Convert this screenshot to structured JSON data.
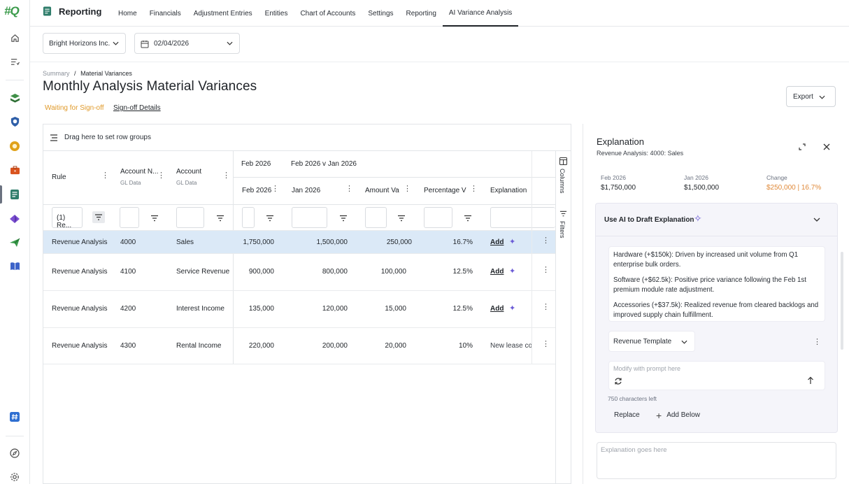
{
  "app": {
    "logo_text": "#Q",
    "title": "Reporting"
  },
  "nav": {
    "items": [
      "Home",
      "Financials",
      "Adjustment Entries",
      "Entities",
      "Chart of Accounts",
      "Settings",
      "Reporting",
      "AI Variance Analysis"
    ],
    "active_index": 7
  },
  "rail": {
    "icons": [
      "home-icon",
      "tasks-icon",
      "stack-icon",
      "shield-icon",
      "coin-icon",
      "briefcase-icon",
      "reporting-icon",
      "diamond-icon",
      "send-icon",
      "book-icon",
      "hash-icon",
      "compass-icon",
      "settings-icon"
    ]
  },
  "filters": {
    "entity": "Bright Horizons Inc.",
    "date": "02/04/2026"
  },
  "page": {
    "breadcrumb_parent": "Summary",
    "breadcrumb_sep": "/",
    "breadcrumb_current": "Material Variances",
    "title": "Monthly Analysis Material Variances",
    "status": "Waiting for Sign-off",
    "signoff_link": "Sign-off Details",
    "export_label": "Export"
  },
  "grid": {
    "row_groups_hint": "Drag here to set row groups",
    "group_header_1": "Feb 2026",
    "group_header_2": "Feb 2026 v Jan 2026",
    "columns": {
      "rule": "Rule",
      "account_no": "Account N...",
      "account_no_sub": "GL Data",
      "account": "Account",
      "account_sub": "GL Data",
      "feb": "Feb 2026",
      "jan": "Jan 2026",
      "amount": "Amount Va",
      "percentage": "Percentage V",
      "explanation": "Explanation"
    },
    "rule_filter_value": "(1) Re...",
    "side_tabs": [
      "Columns",
      "Filters"
    ],
    "add_label": "Add",
    "rows": [
      {
        "rule": "Revenue Analysis",
        "acct_no": "4000",
        "account": "Sales",
        "feb": "1,750,000",
        "jan": "1,500,000",
        "amount": "250,000",
        "pct": "16.7%",
        "explanation": "Add",
        "selected": true
      },
      {
        "rule": "Revenue Analysis",
        "acct_no": "4100",
        "account": "Service Revenue",
        "feb": "900,000",
        "jan": "800,000",
        "amount": "100,000",
        "pct": "12.5%",
        "explanation": "Add",
        "selected": false
      },
      {
        "rule": "Revenue Analysis",
        "acct_no": "4200",
        "account": "Interest Income",
        "feb": "135,000",
        "jan": "120,000",
        "amount": "15,000",
        "pct": "12.5%",
        "explanation": "Add",
        "selected": false
      },
      {
        "rule": "Revenue Analysis",
        "acct_no": "4300",
        "account": "Rental Income",
        "feb": "220,000",
        "jan": "200,000",
        "amount": "20,000",
        "pct": "10%",
        "explanation": "New lease co",
        "selected": false
      }
    ]
  },
  "panel": {
    "title": "Explanation",
    "subtitle": "Revenue Analysis: 4000: Sales",
    "kpis": [
      {
        "label": "Feb 2026",
        "value": "$1,750,000"
      },
      {
        "label": "Jan 2026",
        "value": "$1,500,000"
      },
      {
        "label": "Change",
        "value": "$250,000 | 16.7%"
      }
    ],
    "ai": {
      "heading": "Use AI to Draft Explanation",
      "draft": [
        "Hardware (+$150k): Driven by increased unit volume from Q1 enterprise bulk orders.",
        "Software (+$62.5k): Positive price variance following the Feb 1st premium module rate adjustment.",
        "Accessories (+$37.5k): Realized revenue from cleared backlogs and improved supply chain fulfillment."
      ],
      "template": "Revenue Template",
      "prompt_placeholder": "Modify with prompt here",
      "chars_left": "750 characters left",
      "replace_label": "Replace",
      "add_below_label": "Add Below"
    },
    "explanation_placeholder": "Explanation goes here"
  },
  "colors": {
    "accent_selected_row": "#dbe9f7",
    "status_orange": "#e09a2a",
    "ai_purple": "#6b5bd6",
    "brand_green": "#3a9a4a"
  }
}
